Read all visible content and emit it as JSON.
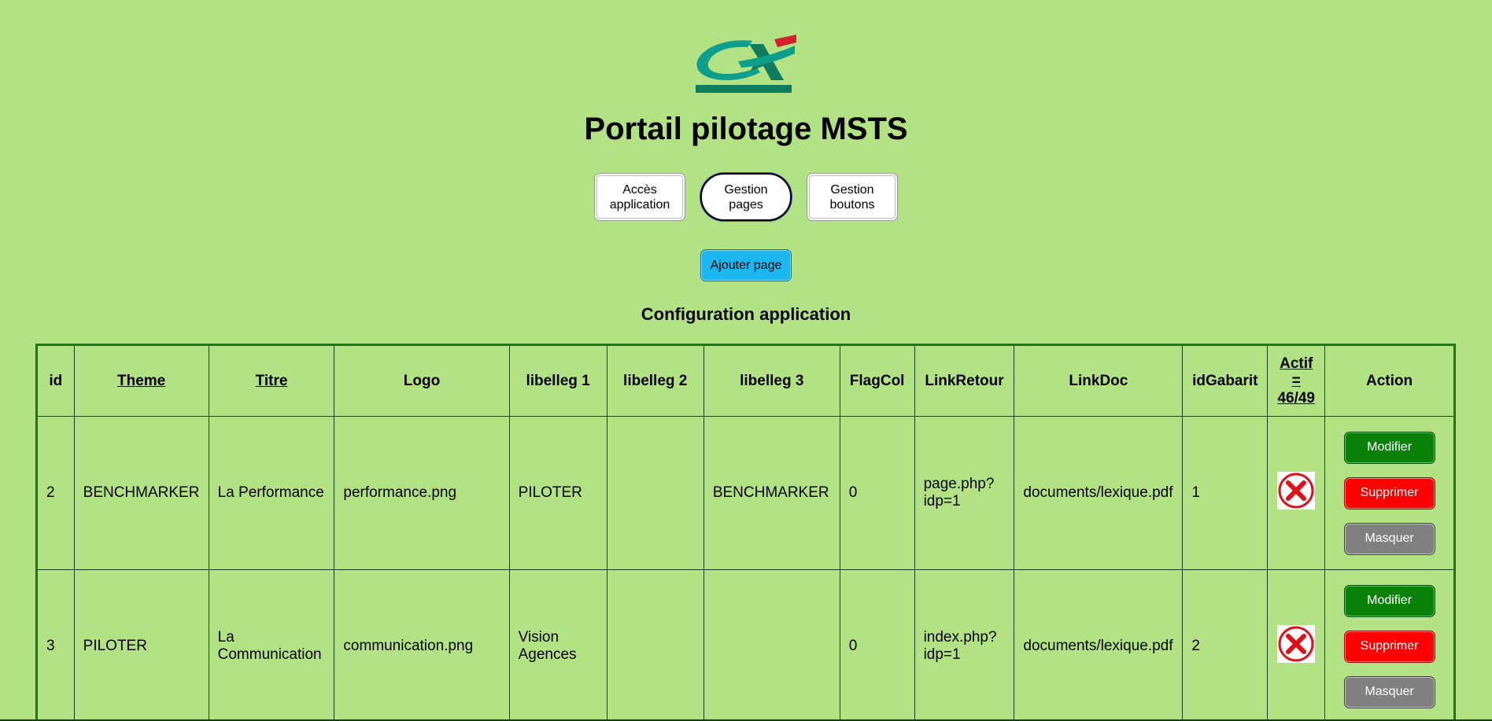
{
  "header": {
    "logo_icon": "credit-agricole-logo",
    "title": "Portail pilotage MSTS"
  },
  "nav": {
    "items": [
      {
        "label": "Accès\napplication",
        "active": false
      },
      {
        "label": "Gestion\npages",
        "active": true
      },
      {
        "label": "Gestion\nboutons",
        "active": false
      }
    ]
  },
  "add_page_label": "Ajouter page",
  "section_title": "Configuration application",
  "table": {
    "columns": [
      "id",
      "Theme",
      "Titre",
      "Logo",
      "libelleg 1",
      "libelleg 2",
      "libelleg 3",
      "FlagCol",
      "LinkRetour",
      "LinkDoc",
      "idGabarit",
      "Actif\n=\n46/49",
      "Action"
    ],
    "rows": [
      {
        "id": "2",
        "theme": "BENCHMARKER",
        "titre": "La Performance",
        "logo": "performance.png",
        "lib1": "PILOTER",
        "lib2": "",
        "lib3": "BENCHMARKER",
        "flagcol": "0",
        "linkretour": "page.php?\nidp=1",
        "linkdoc": "documents/lexique.pdf",
        "idgabarit": "1",
        "actif_icon": "red-x-icon"
      },
      {
        "id": "3",
        "theme": "PILOTER",
        "titre": "La\nCommunication",
        "logo": "communication.png",
        "lib1": "Vision\nAgences",
        "lib2": "",
        "lib3": "",
        "flagcol": "0",
        "linkretour": "index.php?\nidp=1",
        "linkdoc": "documents/lexique.pdf",
        "idgabarit": "2",
        "actif_icon": "red-x-icon"
      }
    ],
    "actions": {
      "modify": "Modifier",
      "delete": "Supprimer",
      "hide": "Masquer"
    }
  },
  "colors": {
    "background": "#b3e285",
    "modify": "#0a820a",
    "delete": "#ff0000",
    "hide": "#808080",
    "add": "#1bb7ee"
  }
}
